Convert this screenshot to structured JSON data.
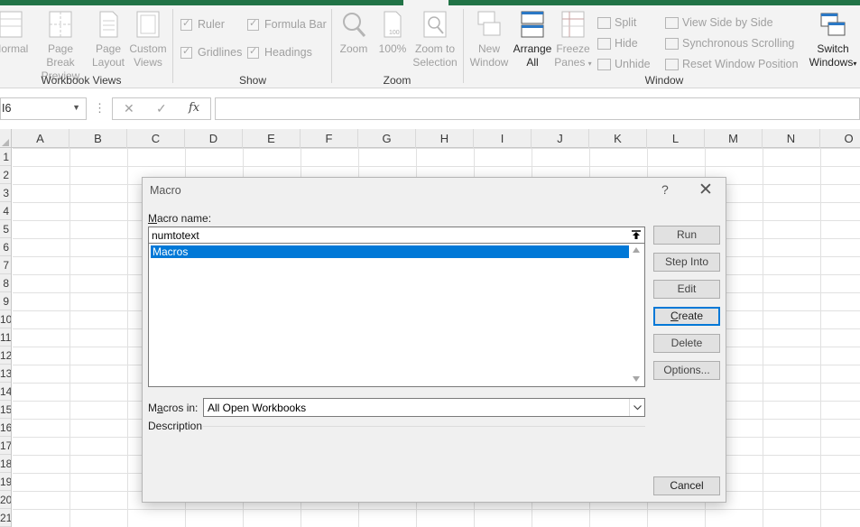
{
  "ribbon": {
    "workbook_views": {
      "label": "Workbook Views",
      "normal": "Normal",
      "page_break_1": "Page Break",
      "page_break_2": "Preview",
      "page_layout_1": "Page",
      "page_layout_2": "Layout",
      "custom_views_1": "Custom",
      "custom_views_2": "Views"
    },
    "show": {
      "label": "Show",
      "ruler": "Ruler",
      "formula_bar": "Formula Bar",
      "gridlines": "Gridlines",
      "headings": "Headings"
    },
    "zoom": {
      "label": "Zoom",
      "zoom": "Zoom",
      "hundred": "100%",
      "zoom_sel_1": "Zoom to",
      "zoom_sel_2": "Selection"
    },
    "window": {
      "label": "Window",
      "new_window_1": "New",
      "new_window_2": "Window",
      "arrange_1": "Arrange",
      "arrange_2": "All",
      "freeze_1": "Freeze",
      "freeze_2": "Panes",
      "split": "Split",
      "hide": "Hide",
      "unhide": "Unhide",
      "side_by_side": "View Side by Side",
      "sync_scroll": "Synchronous Scrolling",
      "reset_pos": "Reset Window Position",
      "switch_1": "Switch",
      "switch_2": "Windows"
    }
  },
  "formula_bar": {
    "name_box": "I6",
    "fx": "fx",
    "value": ""
  },
  "grid": {
    "columns": [
      "A",
      "B",
      "C",
      "D",
      "E",
      "F",
      "G",
      "H",
      "I",
      "J",
      "K",
      "L",
      "M",
      "N",
      "O"
    ],
    "rows": [
      "1",
      "2",
      "3",
      "4",
      "5",
      "6",
      "7",
      "8",
      "9",
      "10",
      "11",
      "12",
      "13",
      "14",
      "15",
      "16",
      "17",
      "18",
      "19",
      "20",
      "21"
    ]
  },
  "dialog": {
    "title": "Macro",
    "help": "?",
    "macro_name_label": "Macro name:",
    "macro_name_value": "numtotext",
    "list_items": [
      "Macros"
    ],
    "macros_in_label": "Macros in:",
    "macros_in_value": "All Open Workbooks",
    "description_label": "Description",
    "buttons": {
      "run": "Run",
      "step_into": "Step Into",
      "edit": "Edit",
      "create": "Create",
      "delete": "Delete",
      "options": "Options...",
      "cancel": "Cancel"
    }
  },
  "colors": {
    "brand_green": "#217346",
    "selection_blue": "#0078d7"
  }
}
